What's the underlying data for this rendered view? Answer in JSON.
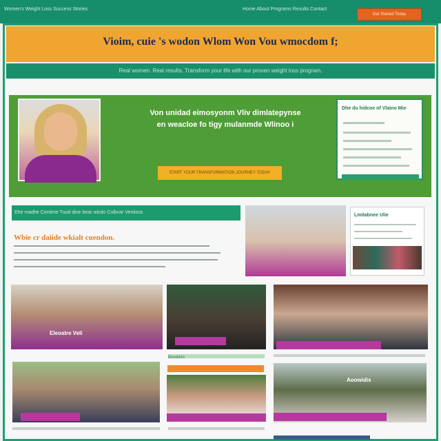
{
  "topbar": {
    "left_text": "Women's Weight Loss Success Stories",
    "nav_text": "Home  About  Programs  Results  Contact",
    "cta_label": "Get Started Today"
  },
  "banner": {
    "title": "Vioim, cuie 's wodon Wlom Won Vou wmocdom f;"
  },
  "subbar": {
    "text": "Real women. Real results. Transform your life with our proven weight loss program."
  },
  "hero": {
    "headline": "Von unidad eimosyonm Vliv dimlatepynse en weacloe fo tigy mulanmde Wlinoo i",
    "button_label": "START YOUR TRANSFORMATION JOURNEY TODAY"
  },
  "form": {
    "title": "Dhe du hidcoe of Vlaino Mie"
  },
  "section2": {
    "bar_text": "Ehe madhe Contime Tuud dine bear wicdo Colbvar Veniioss",
    "heading": "Wbie cr daiide wkialt cuendon."
  },
  "side_card": {
    "title": "Lmitabnee Ulie"
  },
  "tiles": {
    "t1_label": "Eleoatre Veli",
    "t4_label": "Bondoiro",
    "t5_label": "Aoowidis"
  },
  "colors": {
    "primary_green": "#168e6c",
    "accent_orange": "#f0a531",
    "hero_green": "#4f9d36",
    "magenta": "#b5399f"
  }
}
